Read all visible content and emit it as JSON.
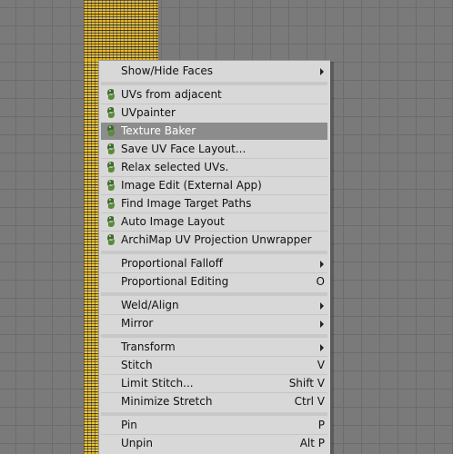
{
  "menu": {
    "items": [
      {
        "label": "Show/Hide Faces",
        "shortcut": "",
        "submenu": true,
        "icon": ""
      },
      {
        "label": "UVs from adjacent",
        "shortcut": "",
        "submenu": false,
        "icon": "python-script-icon"
      },
      {
        "label": "UVpainter",
        "shortcut": "",
        "submenu": false,
        "icon": "python-script-icon"
      },
      {
        "label": "Texture Baker",
        "shortcut": "",
        "submenu": false,
        "icon": "python-script-icon",
        "highlighted": true
      },
      {
        "label": "Save UV Face Layout...",
        "shortcut": "",
        "submenu": false,
        "icon": "python-script-icon"
      },
      {
        "label": "Relax selected UVs.",
        "shortcut": "",
        "submenu": false,
        "icon": "python-script-icon"
      },
      {
        "label": "Image Edit (External App)",
        "shortcut": "",
        "submenu": false,
        "icon": "python-script-icon"
      },
      {
        "label": "Find Image Target Paths",
        "shortcut": "",
        "submenu": false,
        "icon": "python-script-icon"
      },
      {
        "label": "Auto Image Layout",
        "shortcut": "",
        "submenu": false,
        "icon": "python-script-icon"
      },
      {
        "label": "ArchiMap UV Projection Unwrapper",
        "shortcut": "",
        "submenu": false,
        "icon": "python-script-icon"
      },
      {
        "label": "Proportional Falloff",
        "shortcut": "",
        "submenu": true,
        "icon": ""
      },
      {
        "label": "Proportional Editing",
        "shortcut": "O",
        "submenu": false,
        "icon": ""
      },
      {
        "label": "Weld/Align",
        "shortcut": "",
        "submenu": true,
        "icon": ""
      },
      {
        "label": "Mirror",
        "shortcut": "",
        "submenu": true,
        "icon": ""
      },
      {
        "label": "Transform",
        "shortcut": "",
        "submenu": true,
        "icon": ""
      },
      {
        "label": "Stitch",
        "shortcut": "V",
        "submenu": false,
        "icon": ""
      },
      {
        "label": "Limit Stitch...",
        "shortcut": "Shift V",
        "submenu": false,
        "icon": ""
      },
      {
        "label": "Minimize Stretch",
        "shortcut": "Ctrl V",
        "submenu": false,
        "icon": ""
      },
      {
        "label": "Pin",
        "shortcut": "P",
        "submenu": false,
        "icon": ""
      },
      {
        "label": "Unpin",
        "shortcut": "Alt P",
        "submenu": false,
        "icon": ""
      }
    ]
  },
  "colors": {
    "menu_bg": "#d8d8d8",
    "highlight_bg": "#8c8c8c",
    "uv_vertex": "#e8b820",
    "grid_bg": "#7a7a7a"
  }
}
